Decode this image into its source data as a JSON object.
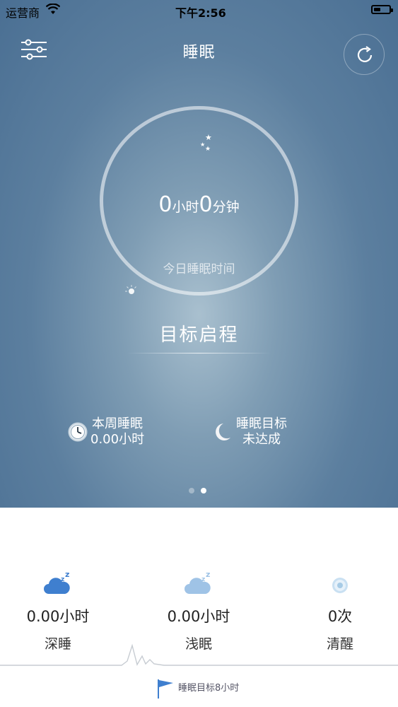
{
  "status_bar": {
    "carrier": "运营商",
    "time": "下午2:56",
    "battery_level": 0.45
  },
  "header": {
    "title": "睡眠"
  },
  "ring": {
    "hours": "0",
    "hours_unit": "小时",
    "minutes": "0",
    "minutes_unit": "分钟",
    "label": "今日睡眠时间"
  },
  "goal_button": {
    "label": "目标启程"
  },
  "week_stat": {
    "line1": "本周睡眠",
    "line2": "0.00小时"
  },
  "goal_stat": {
    "line1": "睡眠目标",
    "line2": "未达成"
  },
  "pager": {
    "pages": 2,
    "active": 2
  },
  "metrics": [
    {
      "icon": "deep-sleep-cloud-icon",
      "value": "0.00小时",
      "name": "深睡",
      "color": "#3f7fcf"
    },
    {
      "icon": "light-sleep-cloud-icon",
      "value": "0.00小时",
      "name": "浅眠",
      "color": "#9fc3e6"
    },
    {
      "icon": "awake-eye-icon",
      "value": "0次",
      "name": "清醒",
      "color": "#a7cbe6"
    }
  ],
  "sleep_goal": {
    "label": "睡眠目标8小时"
  },
  "colors": {
    "accent": "#3f7fcf",
    "hero_dark": "#4a6f93",
    "hero_light": "#a9c0cf"
  }
}
